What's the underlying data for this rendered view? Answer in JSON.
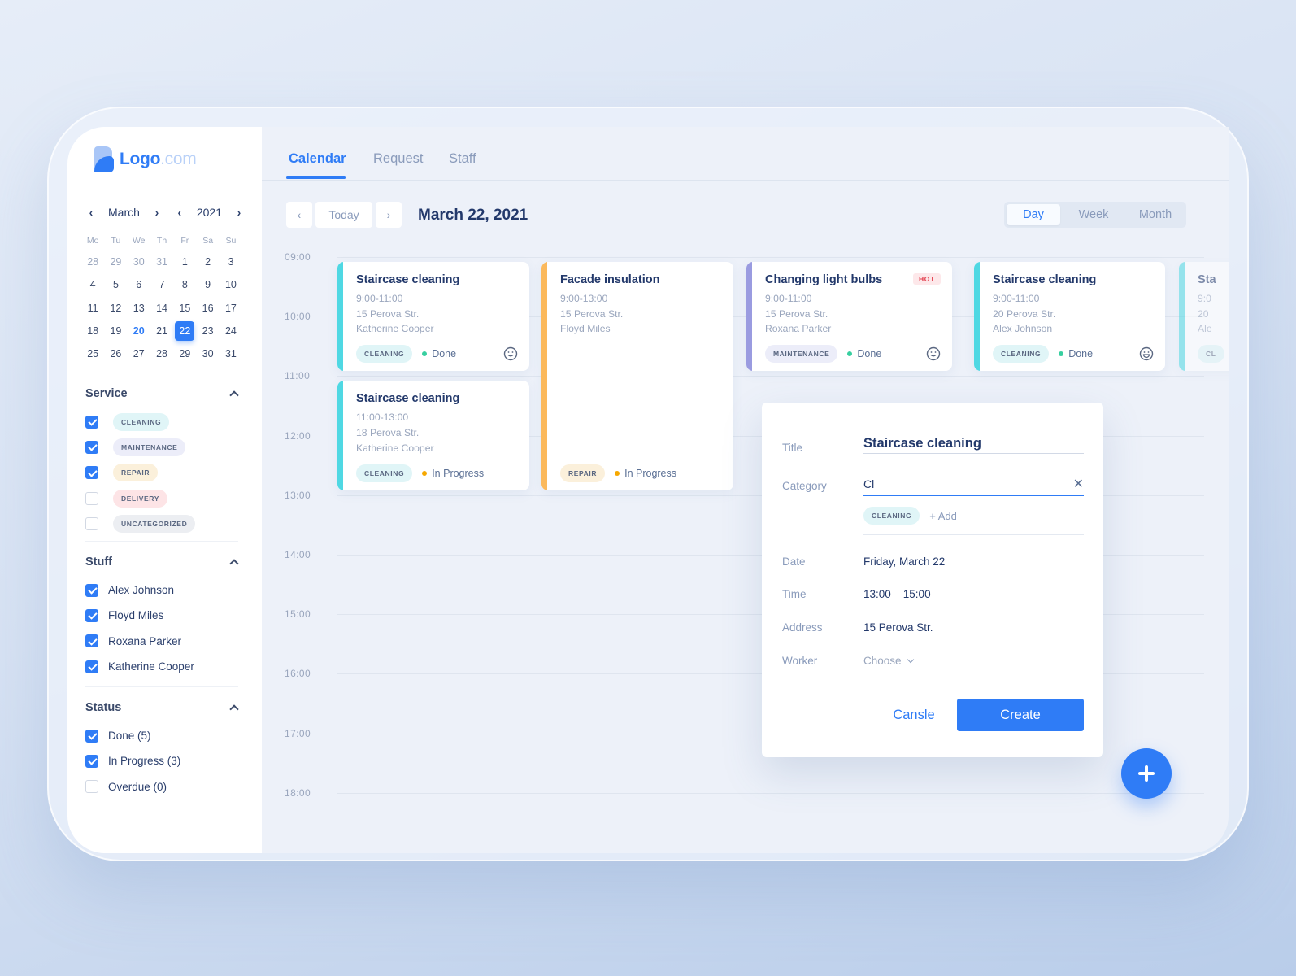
{
  "brand": {
    "name": "Logo",
    "domain": ".com"
  },
  "mini_calendar": {
    "month": "March",
    "year": "2021",
    "weekdays": [
      "Mo",
      "Tu",
      "We",
      "Th",
      "Fr",
      "Sa",
      "Su"
    ],
    "weeks": [
      [
        {
          "d": "28",
          "m": true
        },
        {
          "d": "29",
          "m": true
        },
        {
          "d": "30",
          "m": true
        },
        {
          "d": "31",
          "m": true
        },
        {
          "d": "1"
        },
        {
          "d": "2"
        },
        {
          "d": "3"
        }
      ],
      [
        {
          "d": "4"
        },
        {
          "d": "5"
        },
        {
          "d": "6"
        },
        {
          "d": "7"
        },
        {
          "d": "8"
        },
        {
          "d": "9"
        },
        {
          "d": "10"
        }
      ],
      [
        {
          "d": "11"
        },
        {
          "d": "12"
        },
        {
          "d": "13"
        },
        {
          "d": "14"
        },
        {
          "d": "15"
        },
        {
          "d": "16"
        },
        {
          "d": "17"
        }
      ],
      [
        {
          "d": "18"
        },
        {
          "d": "19"
        },
        {
          "d": "20",
          "today": true
        },
        {
          "d": "21"
        },
        {
          "d": "22",
          "selected": true
        },
        {
          "d": "23"
        },
        {
          "d": "24"
        }
      ],
      [
        {
          "d": "25"
        },
        {
          "d": "26"
        },
        {
          "d": "27"
        },
        {
          "d": "28"
        },
        {
          "d": "29"
        },
        {
          "d": "30"
        },
        {
          "d": "31"
        }
      ]
    ]
  },
  "filters": {
    "service": {
      "title": "Service",
      "items": [
        {
          "label": "CLEANING",
          "key": "cleaning",
          "checked": true
        },
        {
          "label": "MAINTENANCE",
          "key": "maintenance",
          "checked": true
        },
        {
          "label": "REPAIR",
          "key": "repair",
          "checked": true
        },
        {
          "label": "DELIVERY",
          "key": "delivery",
          "checked": false
        },
        {
          "label": "UNCATEGORIZED",
          "key": "uncategorized",
          "checked": false
        }
      ]
    },
    "stuff": {
      "title": "Stuff",
      "items": [
        {
          "label": "Alex Johnson",
          "checked": true
        },
        {
          "label": "Floyd Miles",
          "checked": true
        },
        {
          "label": "Roxana Parker",
          "checked": true
        },
        {
          "label": "Katherine Cooper",
          "checked": true
        }
      ]
    },
    "status": {
      "title": "Status",
      "items": [
        {
          "label": "Done (5)",
          "checked": true
        },
        {
          "label": "In Progress (3)",
          "checked": true
        },
        {
          "label": "Overdue (0)",
          "checked": false
        }
      ]
    }
  },
  "tabs": [
    "Calendar",
    "Request",
    "Staff"
  ],
  "toolbar": {
    "today_label": "Today",
    "current_date": "March 22, 2021",
    "views": [
      "Day",
      "Week",
      "Month"
    ],
    "active_view": "Day"
  },
  "hours": [
    "09:00",
    "10:00",
    "11:00",
    "12:00",
    "13:00",
    "14:00",
    "15:00",
    "16:00",
    "17:00",
    "18:00"
  ],
  "colors": {
    "accent": "#2f7cf6",
    "cleaning": "#4fd8e3",
    "repair": "#fbb95c",
    "maintenance": "#9a9be0",
    "done": "#37cfa0",
    "in_progress": "#f6a800"
  },
  "events": [
    {
      "title": "Staircase cleaning",
      "time": "9:00-11:00",
      "address": "15 Perova Str.",
      "worker": "Katherine Cooper",
      "category": "CLEANING",
      "cat_key": "cleaning",
      "status": "Done",
      "status_key": "done",
      "icon": "smile-icon"
    },
    {
      "title": "Facade insulation",
      "time": "9:00-13:00",
      "address": "15 Perova Str.",
      "worker": "Floyd Miles",
      "category": "REPAIR",
      "cat_key": "repair",
      "status": "In Progress",
      "status_key": "in_progress"
    },
    {
      "title": "Changing light bulbs",
      "time": "9:00-11:00",
      "address": "15 Perova Str.",
      "worker": "Roxana Parker",
      "category": "MAINTENANCE",
      "cat_key": "maintenance",
      "status": "Done",
      "status_key": "done",
      "badge": "HOT",
      "icon": "smile-icon"
    },
    {
      "title": "Staircase cleaning",
      "time": "9:00-11:00",
      "address": "20 Perova Str.",
      "worker": "Alex Johnson",
      "category": "CLEANING",
      "cat_key": "cleaning",
      "status": "Done",
      "status_key": "done",
      "icon": "grin-icon"
    },
    {
      "title": "Staircase cleaning",
      "time": "11:00-13:00",
      "address": "18 Perova Str.",
      "worker": "Katherine Cooper",
      "category": "CLEANING",
      "cat_key": "cleaning",
      "status": "In Progress",
      "status_key": "in_progress"
    },
    {
      "title": "Sta",
      "time": "9:0",
      "address": "20",
      "worker": "Ale",
      "category": "CL",
      "cat_key": "cleaning",
      "partial": true
    }
  ],
  "modal": {
    "title_label": "Title",
    "title_value": "Staircase cleaning",
    "category_label": "Category",
    "category_value": "Cl",
    "category_suggestion": "CLEANING",
    "add_label": "+ Add",
    "date_label": "Date",
    "date_value": "Friday, March 22",
    "time_label": "Time",
    "time_value": "13:00 – 15:00",
    "address_label": "Address",
    "address_value": "15 Perova Str.",
    "worker_label": "Worker",
    "worker_placeholder": "Choose",
    "cancel_label": "Cansle",
    "create_label": "Create"
  }
}
